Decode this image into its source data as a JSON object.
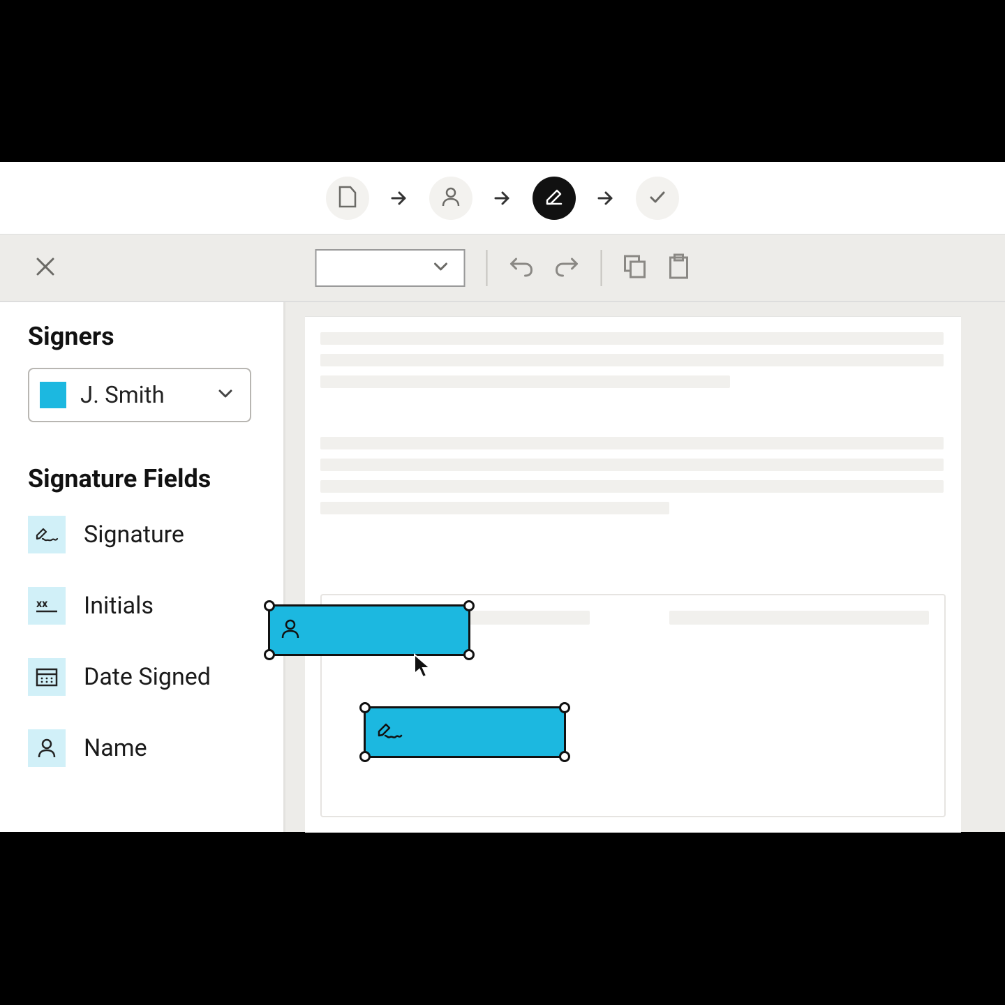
{
  "colors": {
    "accent": "#1cb8e0",
    "icon_bg": "#d1f0f8"
  },
  "sidebar": {
    "signers_title": "Signers",
    "selected_signer": "J. Smith",
    "fields_title": "Signature Fields",
    "fields": [
      {
        "label": "Signature",
        "icon": "signature-icon"
      },
      {
        "label": "Initials",
        "icon": "initials-icon"
      },
      {
        "label": "Date Signed",
        "icon": "calendar-icon"
      },
      {
        "label": "Name",
        "icon": "person-icon"
      }
    ]
  },
  "steps": [
    {
      "icon": "document-icon",
      "active": false
    },
    {
      "icon": "person-icon",
      "active": false
    },
    {
      "icon": "edit-icon",
      "active": true
    },
    {
      "icon": "check-icon",
      "active": false
    }
  ],
  "toolbar": {
    "undo": "undo-icon",
    "redo": "redo-icon",
    "copy": "copy-icon",
    "paste": "clipboard-icon"
  },
  "placed_fields": [
    {
      "type": "name",
      "icon": "person-icon"
    },
    {
      "type": "signature",
      "icon": "signature-icon"
    }
  ]
}
